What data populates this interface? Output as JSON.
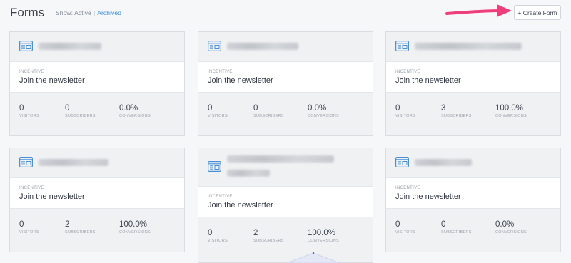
{
  "header": {
    "title": "Forms",
    "show_label": "Show:",
    "active_label": "Active",
    "separator": "|",
    "archived_label": "Archived",
    "create_button": "+ Create Form"
  },
  "colors": {
    "link": "#3d8fd8",
    "arrow": "#ef3f7a",
    "icon": "#4a90d9"
  },
  "labels": {
    "incentive": "INCENTIVE",
    "visitors": "VISITORS",
    "subscribers": "SUBSCRIBERS",
    "conversions": "CONVERSIONS"
  },
  "cards": [
    {
      "incentive": "Join the newsletter",
      "visitors": "0",
      "subscribers": "0",
      "conversions": "0.0%"
    },
    {
      "incentive": "Join the newsletter",
      "visitors": "0",
      "subscribers": "0",
      "conversions": "0.0%"
    },
    {
      "incentive": "Join the newsletter",
      "visitors": "0",
      "subscribers": "3",
      "conversions": "100.0%"
    },
    {
      "incentive": "Join the newsletter",
      "visitors": "0",
      "subscribers": "2",
      "conversions": "100.0%"
    },
    {
      "incentive": "Join the newsletter",
      "visitors": "0",
      "subscribers": "2",
      "conversions": "100.0%"
    },
    {
      "incentive": "Join the newsletter",
      "visitors": "0",
      "subscribers": "0",
      "conversions": "0.0%"
    }
  ]
}
